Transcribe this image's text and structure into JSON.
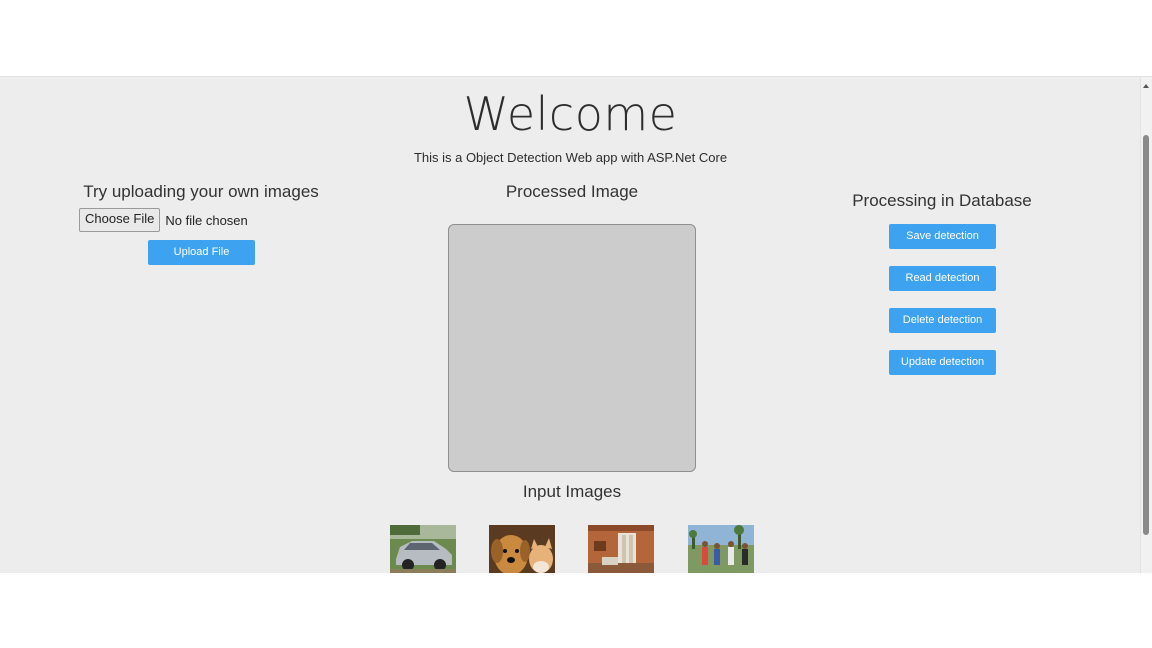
{
  "header": {
    "title": "Welcome",
    "subtitle": "This is a Object Detection Web app with ASP.Net Core"
  },
  "upload": {
    "heading": "Try uploading your own images",
    "choose_label": "Choose File",
    "file_status": "No file chosen",
    "upload_label": "Upload File"
  },
  "processed": {
    "heading": "Processed Image"
  },
  "database": {
    "heading": "Processing in Database",
    "buttons": [
      "Save detection",
      "Read detection",
      "Delete detection",
      "Update detection"
    ]
  },
  "inputs": {
    "heading": "Input Images",
    "thumbnails": [
      "car-thumbnail",
      "dog-cat-thumbnail",
      "room-thumbnail",
      "people-thumbnail"
    ]
  },
  "colors": {
    "accent": "#3da2ef",
    "background": "#ededed",
    "placeholder": "#cccccc"
  }
}
